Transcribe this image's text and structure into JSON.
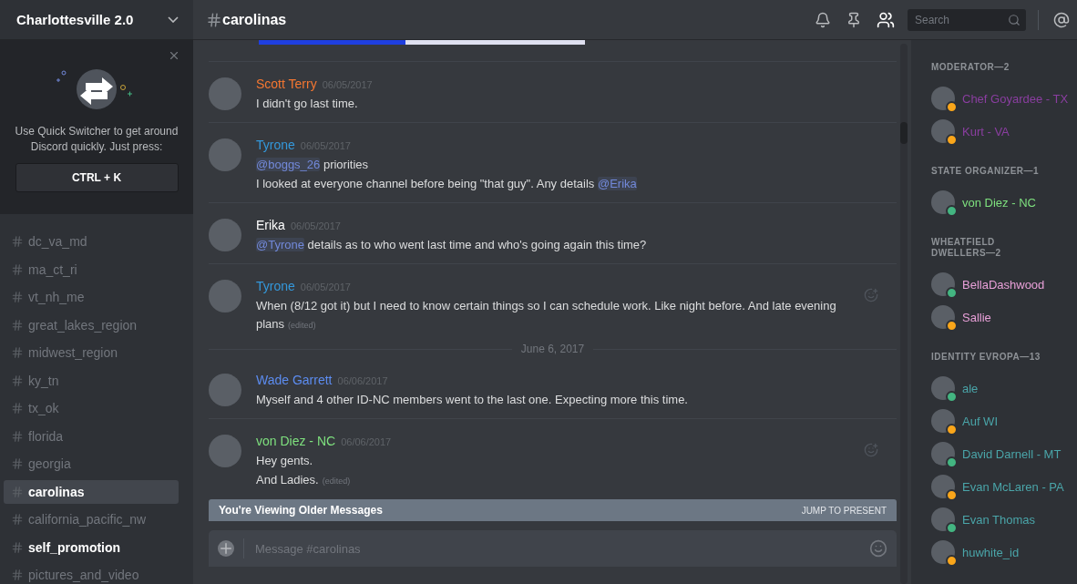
{
  "server": {
    "name": "Charlottesville 2.0"
  },
  "quick_switcher": {
    "text": "Use Quick Switcher to get around Discord quickly. Just press:",
    "shortcut": "CTRL + K"
  },
  "channels": [
    {
      "name": "dc_va_md",
      "selected": false,
      "unread": false
    },
    {
      "name": "ma_ct_ri",
      "selected": false,
      "unread": false
    },
    {
      "name": "vt_nh_me",
      "selected": false,
      "unread": false
    },
    {
      "name": "great_lakes_region",
      "selected": false,
      "unread": false
    },
    {
      "name": "midwest_region",
      "selected": false,
      "unread": false
    },
    {
      "name": "ky_tn",
      "selected": false,
      "unread": false
    },
    {
      "name": "tx_ok",
      "selected": false,
      "unread": false
    },
    {
      "name": "florida",
      "selected": false,
      "unread": false
    },
    {
      "name": "georgia",
      "selected": false,
      "unread": false
    },
    {
      "name": "carolinas",
      "selected": true,
      "unread": false
    },
    {
      "name": "california_pacific_nw",
      "selected": false,
      "unread": false
    },
    {
      "name": "self_promotion",
      "selected": false,
      "unread": true
    },
    {
      "name": "pictures_and_video",
      "selected": false,
      "unread": false
    }
  ],
  "header": {
    "channel": "carolinas",
    "search_placeholder": "Search",
    "members_toggle_on": true
  },
  "feed": [
    {
      "kind": "message",
      "author": "Scott Terry",
      "color": "#f57731",
      "time": "06/05/2017",
      "show_reaction": false,
      "lines": [
        {
          "parts": [
            {
              "kind": "text",
              "text": "I didn't go last time."
            }
          ]
        }
      ]
    },
    {
      "kind": "message",
      "author": "Tyrone",
      "color": "#3498db",
      "time": "06/05/2017",
      "show_reaction": false,
      "lines": [
        {
          "parts": [
            {
              "kind": "mention",
              "text": "@boggs_26"
            },
            {
              "kind": "text",
              "text": " priorities"
            }
          ]
        },
        {
          "parts": [
            {
              "kind": "text",
              "text": "I looked at everyone channel before being \"that guy\". Any details "
            },
            {
              "kind": "mention",
              "text": "@Erika"
            }
          ]
        }
      ]
    },
    {
      "kind": "message",
      "author": "Erika",
      "color": "#ffffff",
      "time": "06/05/2017",
      "show_reaction": false,
      "lines": [
        {
          "parts": [
            {
              "kind": "mention",
              "text": "@Tyrone"
            },
            {
              "kind": "text",
              "text": " details as to who went last time and who's going again this time?"
            }
          ]
        }
      ]
    },
    {
      "kind": "message",
      "author": "Tyrone",
      "color": "#3498db",
      "time": "06/05/2017",
      "show_reaction": true,
      "lines": [
        {
          "parts": [
            {
              "kind": "text",
              "text": "When (8/12 got it) but I need to know certain things so I can schedule work. Like night before. And late evening plans"
            }
          ],
          "edited": "(edited)"
        }
      ]
    },
    {
      "kind": "date",
      "text": "June 6, 2017"
    },
    {
      "kind": "message",
      "author": "Wade Garrett",
      "color": "#5c8cf0",
      "time": "06/06/2017",
      "show_reaction": false,
      "lines": [
        {
          "parts": [
            {
              "kind": "text",
              "text": "Myself and 4 other ID-NC members went to the last one. Expecting more this time."
            }
          ]
        }
      ]
    },
    {
      "kind": "message",
      "author": "von Diez - NC",
      "color": "#7ee07e",
      "time": "06/06/2017",
      "show_reaction": true,
      "lines": [
        {
          "parts": [
            {
              "kind": "text",
              "text": "Hey gents."
            }
          ]
        },
        {
          "parts": [
            {
              "kind": "text",
              "text": "And Ladies."
            }
          ],
          "edited": "(edited)"
        }
      ]
    }
  ],
  "older_bar": {
    "text": "You're Viewing Older Messages",
    "action": "JUMP TO PRESENT"
  },
  "composer": {
    "placeholder": "Message #carolinas"
  },
  "member_groups": [
    {
      "title": "MODERATOR—2",
      "members": [
        {
          "name": "Chef Goyardee - TX",
          "color": "#8a3ea0",
          "idle": true
        },
        {
          "name": "Kurt - VA",
          "color": "#8a3ea0",
          "idle": true
        }
      ]
    },
    {
      "title": "STATE ORGANIZER—1",
      "members": [
        {
          "name": "von Diez - NC",
          "color": "#7ee07e",
          "idle": false
        }
      ]
    },
    {
      "title": "WHEATFIELD DWELLERS—2",
      "members": [
        {
          "name": "BellaDashwood",
          "color": "#e8a0d8",
          "idle": false
        },
        {
          "name": "Sallie",
          "color": "#e8a0d8",
          "idle": true
        }
      ]
    },
    {
      "title": "IDENTITY EVROPA—13",
      "members": [
        {
          "name": "ale",
          "color": "#4aa5a9",
          "idle": false
        },
        {
          "name": "Auf WI",
          "color": "#4aa5a9",
          "idle": true
        },
        {
          "name": "David Darnell - MT",
          "color": "#4aa5a9",
          "idle": false
        },
        {
          "name": "Evan McLaren - PA",
          "color": "#4aa5a9",
          "idle": true
        },
        {
          "name": "Evan Thomas",
          "color": "#4aa5a9",
          "idle": false
        },
        {
          "name": "huwhite_id",
          "color": "#4aa5a9",
          "idle": true
        }
      ]
    }
  ]
}
